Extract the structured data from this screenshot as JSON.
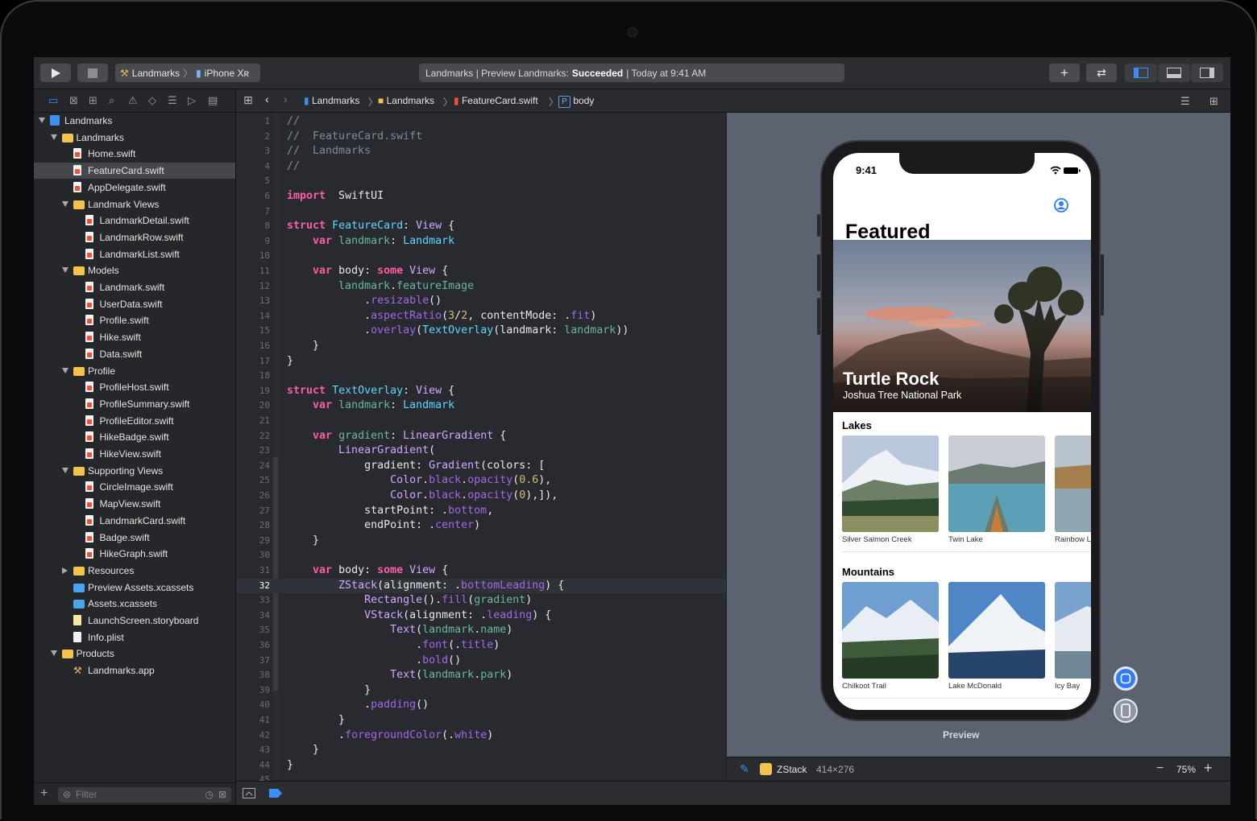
{
  "toolbar": {
    "scheme_target": "Landmarks",
    "scheme_device": "iPhone Xʀ",
    "status_prefix": "Landmarks | Preview Landmarks:",
    "status_state": "Succeeded",
    "status_time": "| Today at 9:41 AM"
  },
  "navigator": {
    "filter_placeholder": "Filter",
    "items": [
      {
        "label": "Landmarks",
        "depth": 0,
        "icon": "project",
        "disclosure": "open"
      },
      {
        "label": "Landmarks",
        "depth": 1,
        "icon": "folder",
        "disclosure": "open"
      },
      {
        "label": "Home.swift",
        "depth": 2,
        "icon": "swift-file"
      },
      {
        "label": "FeatureCard.swift",
        "depth": 2,
        "icon": "swift-file",
        "selected": true
      },
      {
        "label": "AppDelegate.swift",
        "depth": 2,
        "icon": "swift-file"
      },
      {
        "label": "Landmark Views",
        "depth": 2,
        "icon": "folder",
        "disclosure": "open"
      },
      {
        "label": "LandmarkDetail.swift",
        "depth": 3,
        "icon": "swift-file"
      },
      {
        "label": "LandmarkRow.swift",
        "depth": 3,
        "icon": "swift-file"
      },
      {
        "label": "LandmarkList.swift",
        "depth": 3,
        "icon": "swift-file"
      },
      {
        "label": "Models",
        "depth": 2,
        "icon": "folder",
        "disclosure": "open"
      },
      {
        "label": "Landmark.swift",
        "depth": 3,
        "icon": "swift-file"
      },
      {
        "label": "UserData.swift",
        "depth": 3,
        "icon": "swift-file"
      },
      {
        "label": "Profile.swift",
        "depth": 3,
        "icon": "swift-file"
      },
      {
        "label": "Hike.swift",
        "depth": 3,
        "icon": "swift-file"
      },
      {
        "label": "Data.swift",
        "depth": 3,
        "icon": "swift-file"
      },
      {
        "label": "Profile",
        "depth": 2,
        "icon": "folder",
        "disclosure": "open"
      },
      {
        "label": "ProfileHost.swift",
        "depth": 3,
        "icon": "swift-file"
      },
      {
        "label": "ProfileSummary.swift",
        "depth": 3,
        "icon": "swift-file"
      },
      {
        "label": "ProfileEditor.swift",
        "depth": 3,
        "icon": "swift-file"
      },
      {
        "label": "HikeBadge.swift",
        "depth": 3,
        "icon": "swift-file"
      },
      {
        "label": "HikeView.swift",
        "depth": 3,
        "icon": "swift-file"
      },
      {
        "label": "Supporting Views",
        "depth": 2,
        "icon": "folder",
        "disclosure": "open"
      },
      {
        "label": "CircleImage.swift",
        "depth": 3,
        "icon": "swift-file"
      },
      {
        "label": "MapView.swift",
        "depth": 3,
        "icon": "swift-file"
      },
      {
        "label": "LandmarkCard.swift",
        "depth": 3,
        "icon": "swift-file"
      },
      {
        "label": "Badge.swift",
        "depth": 3,
        "icon": "swift-file"
      },
      {
        "label": "HikeGraph.swift",
        "depth": 3,
        "icon": "swift-file"
      },
      {
        "label": "Resources",
        "depth": 2,
        "icon": "folder",
        "disclosure": "closed"
      },
      {
        "label": "Preview Assets.xcassets",
        "depth": 2,
        "icon": "blue-folder"
      },
      {
        "label": "Assets.xcassets",
        "depth": 2,
        "icon": "blue-folder"
      },
      {
        "label": "LaunchScreen.storyboard",
        "depth": 2,
        "icon": "storyboard"
      },
      {
        "label": "Info.plist",
        "depth": 2,
        "icon": "plist"
      },
      {
        "label": "Products",
        "depth": 1,
        "icon": "folder",
        "disclosure": "open"
      },
      {
        "label": "Landmarks.app",
        "depth": 2,
        "icon": "app"
      }
    ]
  },
  "jumpbar": {
    "project": "Landmarks",
    "group": "Landmarks",
    "file": "FeatureCard.swift",
    "symbol_badge": "P",
    "symbol": "body"
  },
  "editor": {
    "current_line": 32,
    "lines": [
      [
        [
          "c",
          "//"
        ]
      ],
      [
        [
          "c",
          "//  FeatureCard.swift"
        ]
      ],
      [
        [
          "c",
          "//  Landmarks"
        ]
      ],
      [
        [
          "c",
          "//"
        ]
      ],
      [],
      [
        [
          "k",
          "import"
        ],
        [
          "",
          "  SwiftUI"
        ]
      ],
      [],
      [
        [
          "k",
          "struct"
        ],
        [
          "",
          " "
        ],
        [
          "t",
          "FeatureCard"
        ],
        [
          "",
          ": "
        ],
        [
          "p",
          "View"
        ],
        [
          "",
          " {"
        ]
      ],
      [
        [
          "",
          "    "
        ],
        [
          "k",
          "var"
        ],
        [
          "",
          " "
        ],
        [
          "v",
          "landmark"
        ],
        [
          "",
          ": "
        ],
        [
          "t",
          "Landmark"
        ]
      ],
      [],
      [
        [
          "",
          "    "
        ],
        [
          "k",
          "var"
        ],
        [
          "",
          " body: "
        ],
        [
          "k",
          "some"
        ],
        [
          "",
          " "
        ],
        [
          "p",
          "View"
        ],
        [
          "",
          " {"
        ]
      ],
      [
        [
          "",
          "        "
        ],
        [
          "v",
          "landmark"
        ],
        [
          "",
          "."
        ],
        [
          "v",
          "featureImage"
        ]
      ],
      [
        [
          "",
          "            ."
        ],
        [
          "f",
          "resizable"
        ],
        [
          "",
          "()"
        ]
      ],
      [
        [
          "",
          "            ."
        ],
        [
          "f",
          "aspectRatio"
        ],
        [
          "",
          "("
        ],
        [
          "n",
          "3"
        ],
        [
          "",
          "/"
        ],
        [
          "n",
          "2"
        ],
        [
          "",
          ", contentMode: ."
        ],
        [
          "f",
          "fit"
        ],
        [
          "",
          ")"
        ]
      ],
      [
        [
          "",
          "            ."
        ],
        [
          "f",
          "overlay"
        ],
        [
          "",
          "("
        ],
        [
          "t",
          "TextOverlay"
        ],
        [
          "",
          "(landmark: "
        ],
        [
          "v",
          "landmark"
        ],
        [
          "",
          "))"
        ]
      ],
      [
        [
          "",
          "    }"
        ]
      ],
      [
        [
          "",
          "}"
        ]
      ],
      [],
      [
        [
          "k",
          "struct"
        ],
        [
          "",
          " "
        ],
        [
          "t",
          "TextOverlay"
        ],
        [
          "",
          ": "
        ],
        [
          "p",
          "View"
        ],
        [
          "",
          " {"
        ]
      ],
      [
        [
          "",
          "    "
        ],
        [
          "k",
          "var"
        ],
        [
          "",
          " "
        ],
        [
          "v",
          "landmark"
        ],
        [
          "",
          ": "
        ],
        [
          "t",
          "Landmark"
        ]
      ],
      [],
      [
        [
          "",
          "    "
        ],
        [
          "k",
          "var"
        ],
        [
          "",
          " "
        ],
        [
          "v",
          "gradient"
        ],
        [
          "",
          ": "
        ],
        [
          "p",
          "LinearGradient"
        ],
        [
          "",
          " {"
        ]
      ],
      [
        [
          "",
          "        "
        ],
        [
          "p",
          "LinearGradient"
        ],
        [
          "",
          "("
        ]
      ],
      [
        [
          "",
          "            gradient: "
        ],
        [
          "p",
          "Gradient"
        ],
        [
          "",
          "(colors: ["
        ]
      ],
      [
        [
          "",
          "                "
        ],
        [
          "p",
          "Color"
        ],
        [
          "",
          "."
        ],
        [
          "f",
          "black"
        ],
        [
          "",
          "."
        ],
        [
          "f",
          "opacity"
        ],
        [
          "",
          "("
        ],
        [
          "n",
          "0.6"
        ],
        [
          "",
          "),"
        ]
      ],
      [
        [
          "",
          "                "
        ],
        [
          "p",
          "Color"
        ],
        [
          "",
          "."
        ],
        [
          "f",
          "black"
        ],
        [
          "",
          "."
        ],
        [
          "f",
          "opacity"
        ],
        [
          "",
          "("
        ],
        [
          "n",
          "0"
        ],
        [
          "",
          "),]),"
        ]
      ],
      [
        [
          "",
          "            startPoint: ."
        ],
        [
          "f",
          "bottom"
        ],
        [
          "",
          ","
        ]
      ],
      [
        [
          "",
          "            endPoint: ."
        ],
        [
          "f",
          "center"
        ],
        [
          "",
          ")"
        ]
      ],
      [
        [
          "",
          "    }"
        ]
      ],
      [],
      [
        [
          "",
          "    "
        ],
        [
          "k",
          "var"
        ],
        [
          "",
          " body: "
        ],
        [
          "k",
          "some"
        ],
        [
          "",
          " "
        ],
        [
          "p",
          "View"
        ],
        [
          "",
          " {"
        ]
      ],
      [
        [
          "",
          "        "
        ],
        [
          "p",
          "ZStack"
        ],
        [
          "",
          "(alignment: ."
        ],
        [
          "f",
          "bottomLeading"
        ],
        [
          "",
          ") {"
        ]
      ],
      [
        [
          "",
          "            "
        ],
        [
          "p",
          "Rectangle"
        ],
        [
          "",
          "()."
        ],
        [
          "f",
          "fill"
        ],
        [
          "",
          "("
        ],
        [
          "v",
          "gradient"
        ],
        [
          "",
          ")"
        ]
      ],
      [
        [
          "",
          "            "
        ],
        [
          "p",
          "VStack"
        ],
        [
          "",
          "(alignment: ."
        ],
        [
          "f",
          "leading"
        ],
        [
          "",
          ") {"
        ]
      ],
      [
        [
          "",
          "                "
        ],
        [
          "p",
          "Text"
        ],
        [
          "",
          "("
        ],
        [
          "v",
          "landmark"
        ],
        [
          "",
          "."
        ],
        [
          "v",
          "name"
        ],
        [
          "",
          ")"
        ]
      ],
      [
        [
          "",
          "                    ."
        ],
        [
          "f",
          "font"
        ],
        [
          "",
          "(."
        ],
        [
          "f",
          "title"
        ],
        [
          "",
          ")"
        ]
      ],
      [
        [
          "",
          "                    ."
        ],
        [
          "f",
          "bold"
        ],
        [
          "",
          "()"
        ]
      ],
      [
        [
          "",
          "                "
        ],
        [
          "p",
          "Text"
        ],
        [
          "",
          "("
        ],
        [
          "v",
          "landmark"
        ],
        [
          "",
          "."
        ],
        [
          "v",
          "park"
        ],
        [
          "",
          ")"
        ]
      ],
      [
        [
          "",
          "            }"
        ]
      ],
      [
        [
          "",
          "            ."
        ],
        [
          "f",
          "padding"
        ],
        [
          "",
          "()"
        ]
      ],
      [
        [
          "",
          "        }"
        ]
      ],
      [
        [
          "",
          "        ."
        ],
        [
          "f",
          "foregroundColor"
        ],
        [
          "",
          "(."
        ],
        [
          "f",
          "white"
        ],
        [
          "",
          ")"
        ]
      ],
      [
        [
          "",
          "    }"
        ]
      ],
      [
        [
          "",
          "}"
        ]
      ],
      []
    ]
  },
  "canvas": {
    "phone_time": "9:41",
    "featured_title": "Featured",
    "hero_title": "Turtle Rock",
    "hero_subtitle": "Joshua Tree National Park",
    "categories": [
      {
        "name": "Lakes",
        "items": [
          "Silver Salmon Creek",
          "Twin Lake",
          "Rainbow L"
        ]
      },
      {
        "name": "Mountains",
        "items": [
          "Chilkoot Trail",
          "Lake McDonald",
          "Icy Bay"
        ]
      }
    ],
    "preview_label": "Preview"
  },
  "inspector_bar": {
    "view_name": "ZStack",
    "view_size": "414×276",
    "zoom": "75%"
  },
  "colors": {
    "accent": "#3478f6",
    "keyword": "#fc5fa3",
    "type": "#5dd8ff"
  }
}
